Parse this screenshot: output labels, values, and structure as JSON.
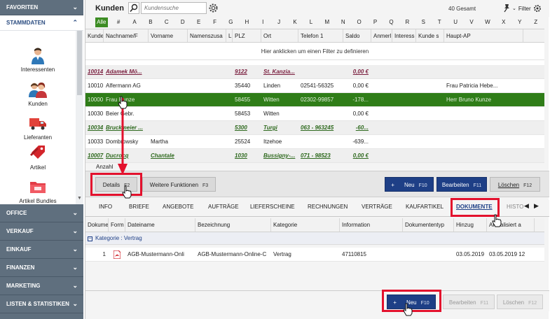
{
  "sidebar": {
    "sections_top": [
      {
        "label": "FAVORITEN"
      },
      {
        "label": "STAMMDATEN"
      }
    ],
    "items": [
      {
        "label": "Interessenten",
        "icon": "person-icon"
      },
      {
        "label": "Kunden",
        "icon": "customers-icon"
      },
      {
        "label": "Lieferanten",
        "icon": "truck-icon"
      },
      {
        "label": "Artikel",
        "icon": "tag-icon"
      },
      {
        "label": "Artikel Bundles",
        "icon": "folder-icon"
      }
    ],
    "sections_bottom": [
      {
        "label": "OFFICE"
      },
      {
        "label": "VERKAUF"
      },
      {
        "label": "EINKAUF"
      },
      {
        "label": "FINANZEN"
      },
      {
        "label": "MARKETING"
      },
      {
        "label": "LISTEN & STATISTIKEN"
      }
    ]
  },
  "header": {
    "title": "Kunden",
    "search_placeholder": "Kundensuche",
    "total_count": "40 Gesamt",
    "filter_label": "Filter"
  },
  "alphabet": [
    "Alle",
    "#",
    "A",
    "B",
    "C",
    "D",
    "E",
    "F",
    "G",
    "H",
    "I",
    "J",
    "K",
    "L",
    "M",
    "N",
    "O",
    "P",
    "Q",
    "R",
    "S",
    "T",
    "U",
    "V",
    "W",
    "X",
    "Y",
    "Z"
  ],
  "grid": {
    "columns": [
      "Kunden",
      "Nachname/F",
      "Vorname",
      "Namenszusa",
      "L",
      "PLZ",
      "Ort",
      "Telefon 1",
      "Saldo",
      "Anmerl",
      "Interess",
      "Kunde s",
      "Haupt-AP"
    ],
    "filter_hint": "Hier anklicken um einen Filter zu definieren",
    "rows": [
      {
        "style": "linkp",
        "cells": [
          "10014",
          "Adamek Mö...",
          "",
          "",
          "",
          "9122",
          "St. Kanzia...",
          "",
          "0,00 €",
          "",
          "",
          "",
          ""
        ]
      },
      {
        "style": "plain",
        "cells": [
          "10010",
          "Alfermann AG",
          "",
          "",
          "",
          "35440",
          "Linden",
          "02541-56325",
          "0,00 €",
          "",
          "",
          "",
          "Frau Patricia Hebe..."
        ]
      },
      {
        "style": "selected",
        "cells": [
          "10000",
          "Frau Kunze",
          "",
          "",
          "",
          "58455",
          "Witten",
          "02302-99857",
          "-178...",
          "",
          "",
          "",
          "Herr Bruno Kunze"
        ]
      },
      {
        "style": "plain",
        "cells": [
          "10030",
          "Beier Gebr.",
          "",
          "",
          "",
          "58453",
          "Witten",
          "",
          "0,00 €",
          "",
          "",
          "",
          ""
        ]
      },
      {
        "style": "link",
        "cells": [
          "10034",
          "Bruckmeier ...",
          "",
          "",
          "",
          "5300",
          "Turgi",
          "063 - 963245",
          "-60...",
          "",
          "",
          "",
          ""
        ]
      },
      {
        "style": "plain",
        "cells": [
          "10033",
          "Dombrowsky",
          "Martha",
          "",
          "",
          "25524",
          "Itzehoe",
          "",
          "-639...",
          "",
          "",
          "",
          ""
        ]
      },
      {
        "style": "link",
        "cells": [
          "10007",
          "Ducrocq",
          "Chantale",
          "",
          "",
          "1030",
          "Bussigny-...",
          "071 - 98523",
          "0,00 €",
          "",
          "",
          "",
          ""
        ]
      }
    ],
    "count_label": "Anzahl"
  },
  "buttons": {
    "details": "Details",
    "details_key": "F2",
    "more": "Weitere Funktionen",
    "more_key": "F3",
    "new": "Neu",
    "new_key": "F10",
    "edit": "Bearbeiten",
    "edit_key": "F11",
    "delete": "Löschen",
    "delete_key": "F12",
    "plus": "+"
  },
  "tabs": [
    "INFO",
    "BRIEFE",
    "ANGEBOTE",
    "AUFTRÄGE",
    "LIEFERSCHEINE",
    "RECHNUNGEN",
    "VERTRÄGE",
    "KAUFARTIKEL",
    "DOKUMENTE",
    "HISTO"
  ],
  "tab_active": "DOKUMENTE",
  "documents": {
    "columns": [
      "Dokumer",
      "Form",
      "Dateiname",
      "Bezeichnung",
      "Kategorie",
      "Information",
      "Dokumententyp",
      "Hinzug",
      "Aktualisiert a"
    ],
    "category_label": "Kategorie : Vertrag",
    "rows": [
      {
        "cells": [
          "1",
          "",
          "AGB-Mustermann-Onli",
          "AGB-Mustermann-Online-C",
          "Vertrag",
          "47110815",
          "",
          "03.05.2019",
          "03.05.2019 12"
        ]
      }
    ]
  },
  "colors": {
    "sidebar": "#5f6f7e",
    "selected_row": "#2f7d18",
    "primary_button": "#1e3f86",
    "highlight": "#e3112d"
  }
}
